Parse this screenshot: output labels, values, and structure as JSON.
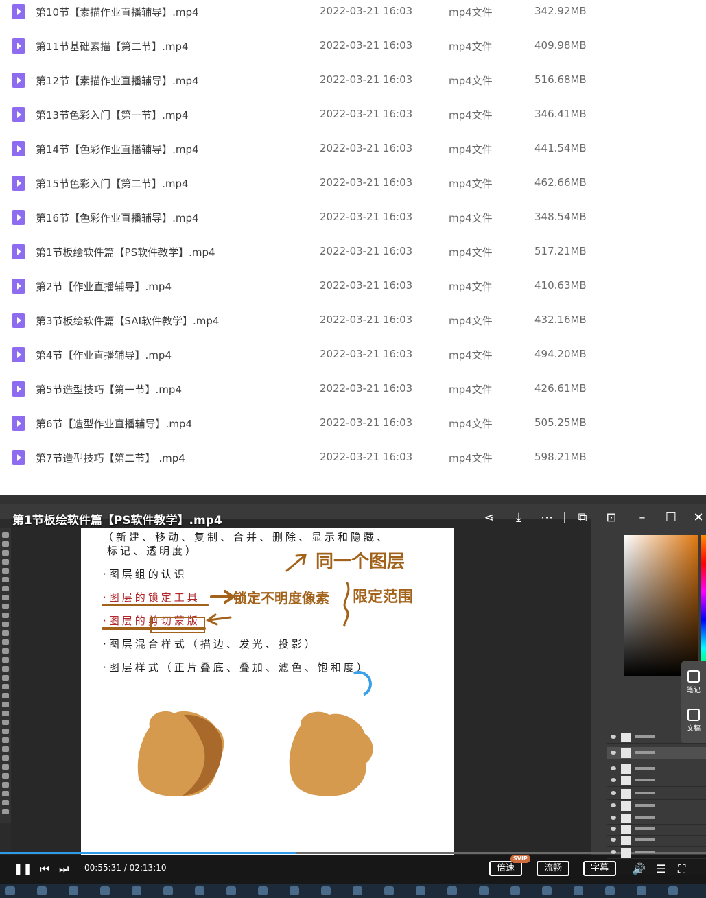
{
  "files": [
    {
      "name": "第10节【素描作业直播辅导】.mp4",
      "date": "2022-03-21 16:03",
      "type": "mp4文件",
      "size": "342.92MB"
    },
    {
      "name": "第11节基础素描【第二节】.mp4",
      "date": "2022-03-21 16:03",
      "type": "mp4文件",
      "size": "409.98MB"
    },
    {
      "name": "第12节【素描作业直播辅导】.mp4",
      "date": "2022-03-21 16:03",
      "type": "mp4文件",
      "size": "516.68MB"
    },
    {
      "name": "第13节色彩入门【第一节】.mp4",
      "date": "2022-03-21 16:03",
      "type": "mp4文件",
      "size": "346.41MB"
    },
    {
      "name": "第14节【色彩作业直播辅导】.mp4",
      "date": "2022-03-21 16:03",
      "type": "mp4文件",
      "size": "441.54MB"
    },
    {
      "name": "第15节色彩入门【第二节】.mp4",
      "date": "2022-03-21 16:03",
      "type": "mp4文件",
      "size": "462.66MB"
    },
    {
      "name": "第16节【色彩作业直播辅导】.mp4",
      "date": "2022-03-21 16:03",
      "type": "mp4文件",
      "size": "348.54MB"
    },
    {
      "name": "第1节板绘软件篇【PS软件教学】.mp4",
      "date": "2022-03-21 16:03",
      "type": "mp4文件",
      "size": "517.21MB"
    },
    {
      "name": "第2节【作业直播辅导】.mp4",
      "date": "2022-03-21 16:03",
      "type": "mp4文件",
      "size": "410.63MB"
    },
    {
      "name": "第3节板绘软件篇【SAI软件教学】.mp4",
      "date": "2022-03-21 16:03",
      "type": "mp4文件",
      "size": "432.16MB"
    },
    {
      "name": "第4节【作业直播辅导】.mp4",
      "date": "2022-03-21 16:03",
      "type": "mp4文件",
      "size": "494.20MB"
    },
    {
      "name": "第5节造型技巧【第一节】.mp4",
      "date": "2022-03-21 16:03",
      "type": "mp4文件",
      "size": "426.61MB"
    },
    {
      "name": "第6节【造型作业直播辅导】.mp4",
      "date": "2022-03-21 16:03",
      "type": "mp4文件",
      "size": "505.25MB"
    },
    {
      "name": "第7节造型技巧【第二节】 .mp4",
      "date": "2022-03-21 16:03",
      "type": "mp4文件",
      "size": "598.21MB"
    }
  ],
  "player": {
    "title": "第1节板绘软件篇【PS软件教学】.mp4",
    "current_time": "00:55:31",
    "time_separator": "/",
    "total_time": "02:13:10",
    "progress": 0.42,
    "speed_label": "倍速",
    "svip_badge": "SVIP",
    "quality_label": "流畅",
    "subtitle_label": "字幕",
    "side_panel": {
      "notes_label": "笔记",
      "doc_label": "文稿"
    }
  },
  "slide": {
    "line0": "（新建、移动、复制、合并、删除、显示和隐藏、",
    "line1": "标记、透明度）",
    "items": [
      "·图层组的认识",
      "·图层的锁定工具",
      "·图层的剪切蒙版",
      "·图层混合样式（描边、发光、投影）",
      "·图层样式（正片叠底、叠加、滤色、饱和度）"
    ],
    "notes": {
      "same_layer": "同一个图层",
      "lock_pixels": "锁定不明度像素",
      "limit_range": "限定范围"
    },
    "blob_color": "#d69a4f",
    "blob_shadow": "#a8692b"
  },
  "colors": {
    "file_icon": "#8e6cf0",
    "progress": "#2f9ae8",
    "accent_handwriting": "#a3621a"
  }
}
